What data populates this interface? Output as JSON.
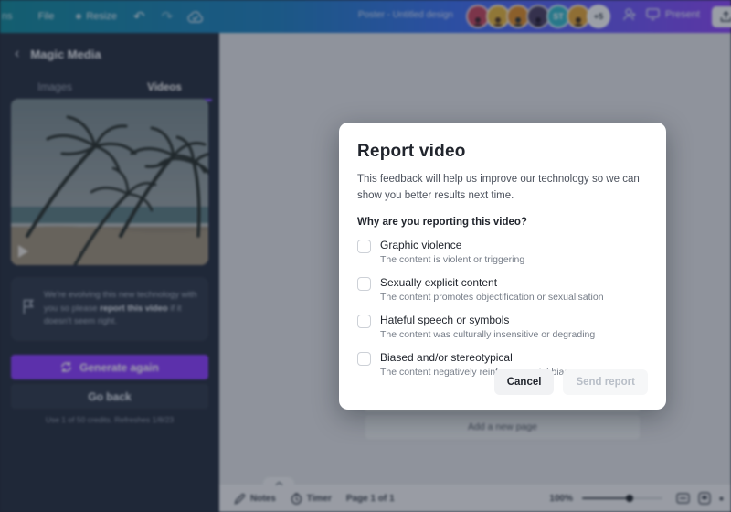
{
  "colors": {
    "accent_purple": "#8b3dff",
    "header_teal": "#12899c",
    "header_purple": "#8a46f7",
    "sidebar_bg": "#262f40"
  },
  "header": {
    "edge_fragment": "ns",
    "file_label": "File",
    "resize_label": "Resize",
    "undo_glyph": "↶",
    "redo_glyph": "↷",
    "doc_title": "Poster - Untitled design",
    "avatars": [
      {
        "css": "background:#c0455e"
      },
      {
        "css": "background:#e2b23e"
      },
      {
        "css": "background:#d98a2b"
      },
      {
        "css": "background:#4a3f63"
      },
      {
        "css": "background:#35b5c9",
        "initials": "ST"
      },
      {
        "css": "background:#e0a33a"
      }
    ],
    "overflow_badge": "+5",
    "present_label": "Present"
  },
  "sidebar": {
    "back_glyph": "‹",
    "title": "Magic Media",
    "tabs": [
      {
        "label": "Images"
      },
      {
        "label": "Videos"
      }
    ],
    "notice_before": "We're evolving this new technology with you so please ",
    "notice_bold": "report this video",
    "notice_after": " if it doesn't seem right.",
    "generate_label": "Generate again",
    "goback_label": "Go back",
    "credits": "Use 1 of 50 credits. Refreshes 1/8/23"
  },
  "canvas": {
    "add_page_label": "Add a new page"
  },
  "modal": {
    "title": "Report video",
    "description": "This feedback will help us improve our technology so we can show you better results next time.",
    "question": "Why are you reporting this video?",
    "options": [
      {
        "label": "Graphic violence",
        "description": "The content is violent or triggering"
      },
      {
        "label": "Sexually explicit content",
        "description": "The content promotes objectification or sexualisation"
      },
      {
        "label": "Hateful speech or symbols",
        "description": "The content was culturally insensitive or degrading"
      },
      {
        "label": "Biased and/or stereotypical",
        "description": "The content negatively reinforces social biases"
      }
    ],
    "cancel_label": "Cancel",
    "send_label": "Send report"
  },
  "footer": {
    "notes_label": "Notes",
    "timer_label": "Timer",
    "page_indicator": "Page 1 of 1",
    "zoom_level": "100%",
    "collapse_glyph": "⌃"
  }
}
